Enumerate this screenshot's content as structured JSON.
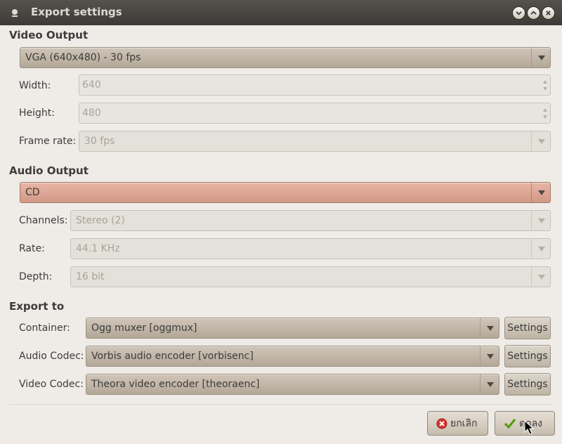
{
  "window": {
    "title": "Export settings"
  },
  "video": {
    "section": "Video Output",
    "preset": "VGA (640x480) - 30 fps",
    "width_label": "Width:",
    "width_value": "640",
    "height_label": "Height:",
    "height_value": "480",
    "framerate_label": "Frame rate:",
    "framerate_value": "30 fps"
  },
  "audio": {
    "section": "Audio Output",
    "preset": "CD",
    "channels_label": "Channels:",
    "channels_value": "Stereo (2)",
    "rate_label": "Rate:",
    "rate_value": "44.1 KHz",
    "depth_label": "Depth:",
    "depth_value": "16 bit"
  },
  "export": {
    "section": "Export to",
    "container_label": "Container:",
    "container_value": "Ogg muxer [oggmux]",
    "audio_codec_label": "Audio Codec:",
    "audio_codec_value": "Vorbis audio encoder [vorbisenc]",
    "video_codec_label": "Video Codec:",
    "video_codec_value": "Theora video encoder [theoraenc]",
    "settings_label": "Settings"
  },
  "actions": {
    "cancel": "ยกเลิก",
    "ok": "ตกลง"
  },
  "colors": {
    "titlebar": "#3c3b37",
    "accent_active": "#d29886",
    "close_red": "#d8322c",
    "check_green": "#4e9a06"
  }
}
